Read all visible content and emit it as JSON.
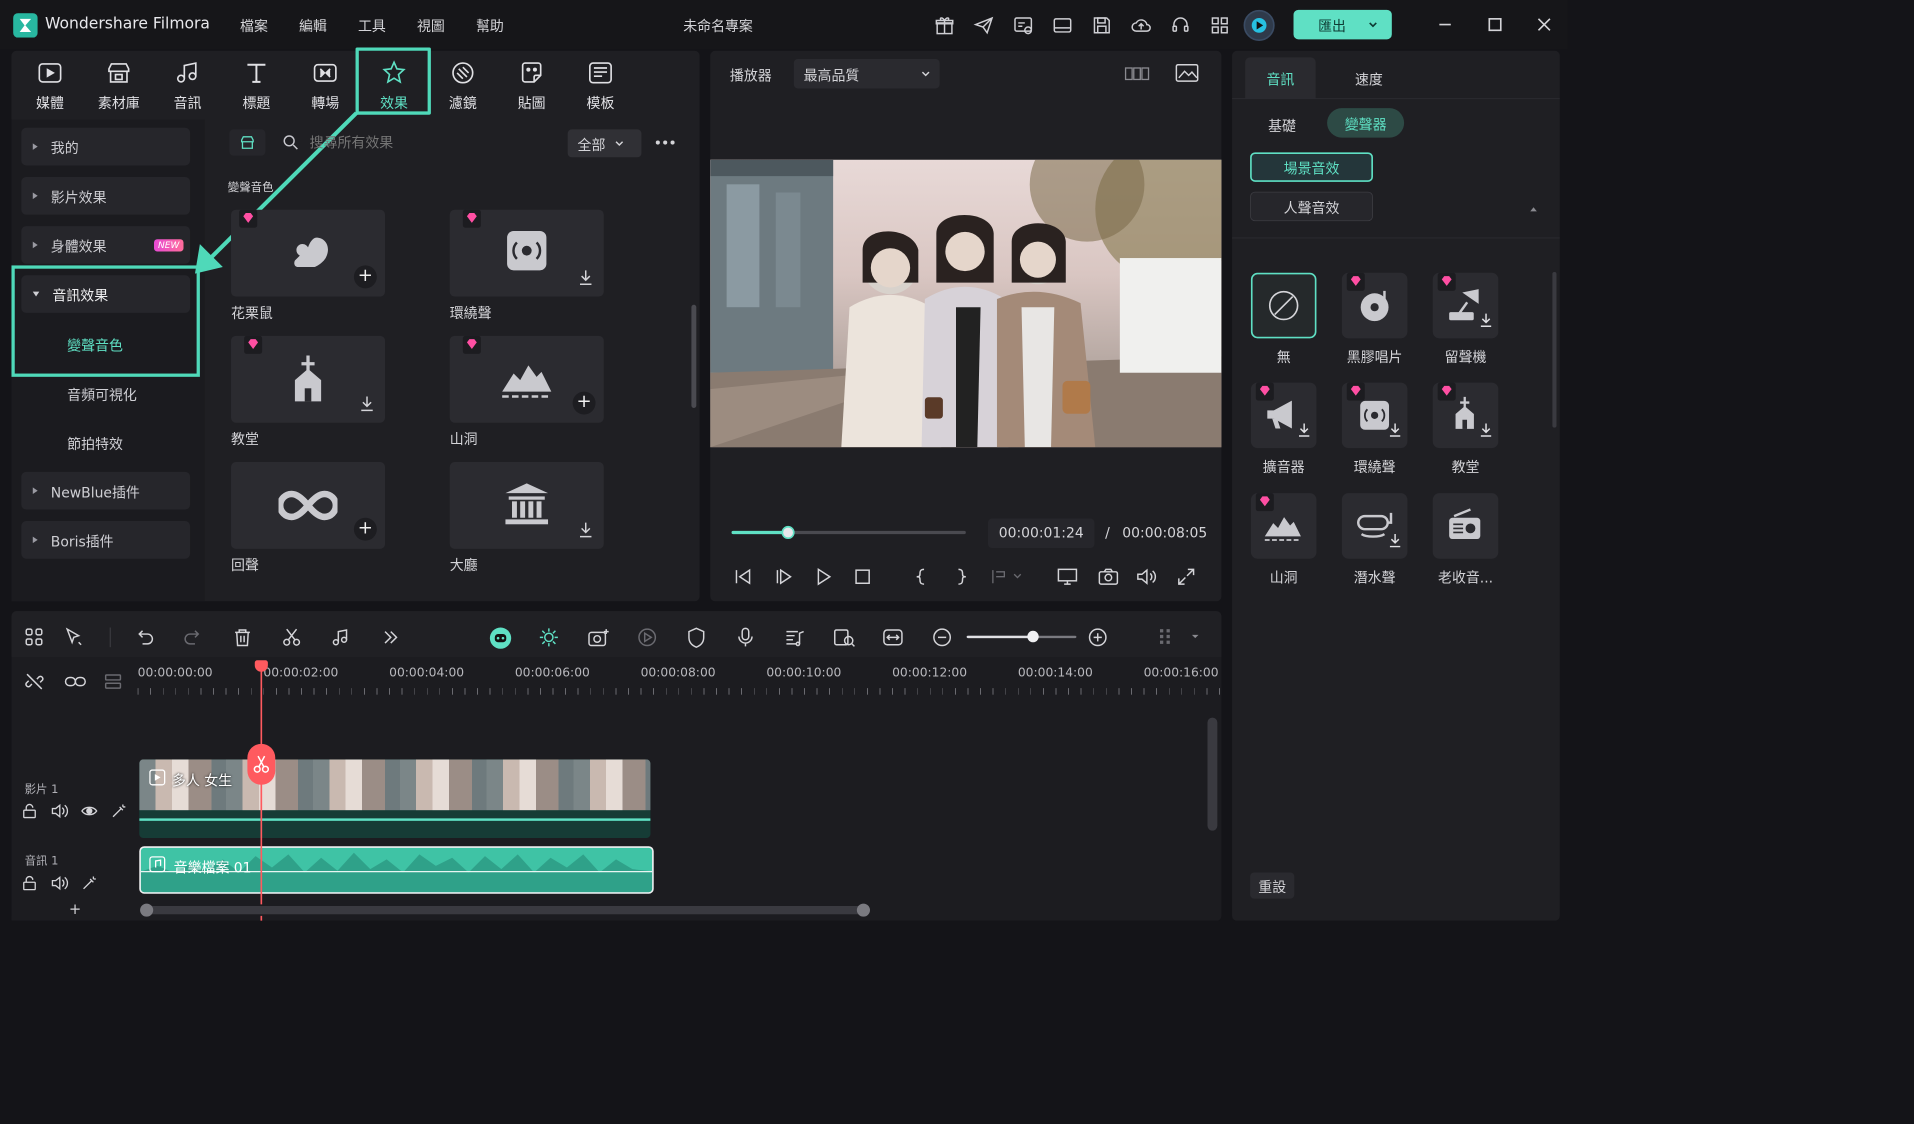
{
  "app": {
    "name": "Wondershare Filmora",
    "project": "未命名專案",
    "export": "匯出"
  },
  "menu": [
    "檔案",
    "編輯",
    "工具",
    "視圖",
    "幫助"
  ],
  "toolbar": [
    "媒體",
    "素材庫",
    "音訊",
    "標題",
    "轉場",
    "效果",
    "濾鏡",
    "貼圖",
    "模板"
  ],
  "sidebar": {
    "items": [
      "我的",
      "影片效果",
      "身體效果",
      "音訊效果",
      "NewBlue插件",
      "Boris插件"
    ],
    "sub": [
      "變聲音色",
      "音頻可視化",
      "節拍特效"
    ],
    "new_badge": "NEW"
  },
  "browser": {
    "search_placeholder": "搜尋所有效果",
    "filter": "全部",
    "section": "變聲音色",
    "cards": [
      "花栗鼠",
      "環繞聲",
      "教堂",
      "山洞",
      "回聲",
      "大廳"
    ]
  },
  "player": {
    "label": "播放器",
    "quality": "最高品質",
    "time_current": "00:00:01:24",
    "time_sep": "/",
    "time_total": "00:00:08:05",
    "progress": 0.24
  },
  "right": {
    "tabs": [
      "音訊",
      "速度"
    ],
    "subtabs": [
      "基礎",
      "變聲器"
    ],
    "groups": [
      "場景音效",
      "人聲音效"
    ],
    "effects": [
      "無",
      "黑膠唱片",
      "留聲機",
      "擴音器",
      "環繞聲",
      "教堂",
      "山洞",
      "潛水聲",
      "老收音..."
    ],
    "reset": "重設"
  },
  "timeline": {
    "ruler": [
      "00:00:00:00",
      "00:00:02:00",
      "00:00:04:00",
      "00:00:06:00",
      "00:00:08:00",
      "00:00:10:00",
      "00:00:12:00",
      "00:00:14:00",
      "00:00:16:00"
    ],
    "video_track": "影片 1",
    "audio_track": "音訊 1",
    "video_clip": "多人 女生",
    "audio_clip": "音樂檔案 01",
    "add": "+"
  },
  "colors": {
    "accent": "#5fe0c4",
    "highlight": "#4fd9b9",
    "playhead": "#ff5a5f"
  }
}
